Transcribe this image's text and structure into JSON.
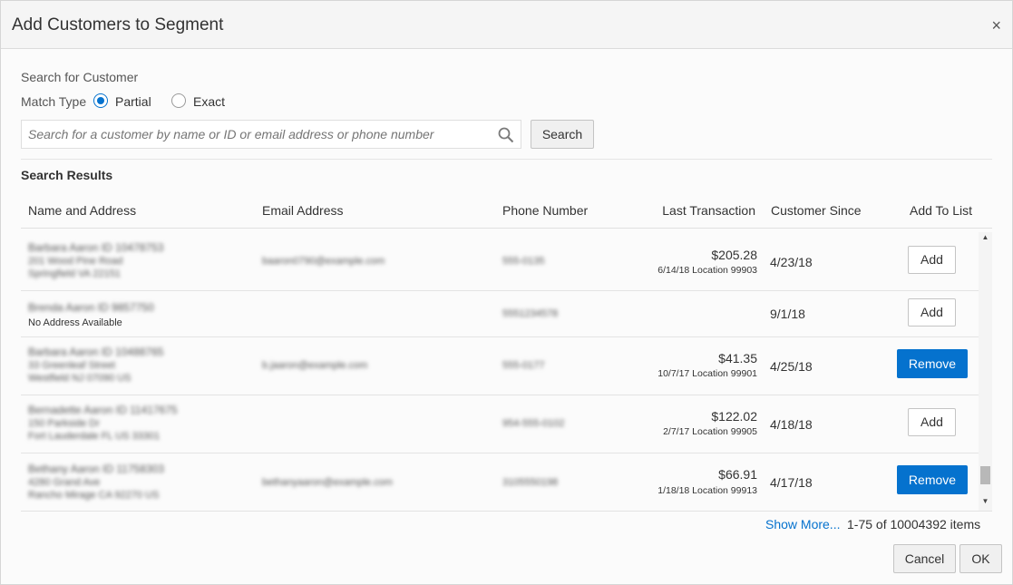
{
  "dialog": {
    "title": "Add Customers to Segment",
    "close_glyph": "×"
  },
  "search": {
    "section_label": "Search for Customer",
    "match_type_label": "Match Type",
    "options": [
      {
        "label": "Partial",
        "selected": true
      },
      {
        "label": "Exact",
        "selected": false
      }
    ],
    "placeholder": "Search for a customer by name or ID or email address or phone number",
    "value": "",
    "button_label": "Search"
  },
  "results": {
    "title": "Search Results",
    "columns": {
      "name": "Name and Address",
      "email": "Email Address",
      "phone": "Phone Number",
      "last_transaction": "Last Transaction",
      "since": "Customer Since",
      "add": "Add To List"
    },
    "rows": [
      {
        "name": "Barbara Aaron ID 10478753",
        "address1": "201 Wood Pine Road",
        "address2": "Springfield VA 22151",
        "email": "baaron0790@example.com",
        "phone": "555-0135",
        "amount": "$205.28",
        "txn_detail": "6/14/18 Location 99903",
        "since": "4/23/18",
        "action": "Add"
      },
      {
        "name": "Brenda Aaron ID 9857750",
        "address1": "No Address Available",
        "email": "",
        "phone": "5551234578",
        "amount": "",
        "txn_detail": "",
        "since": "9/1/18",
        "action": "Add"
      },
      {
        "name": "Barbara Aaron ID 10488765",
        "address1": "33 Greenleaf Street",
        "address2": "Westfield NJ 07090 US",
        "email": "b.jaaron@example.com",
        "phone": "555-0177",
        "amount": "$41.35",
        "txn_detail": "10/7/17 Location 99901",
        "since": "4/25/18",
        "action": "Remove"
      },
      {
        "name": "Bernadette Aaron ID 11417675",
        "address1": "150 Parkside Dr",
        "address2": "Fort Lauderdale FL US 33301",
        "email": "",
        "phone": "954-555-0102",
        "amount": "$122.02",
        "txn_detail": "2/7/17 Location 99905",
        "since": "4/18/18",
        "action": "Add"
      },
      {
        "name": "Bethany Aaron ID 11758303",
        "address1": "4280 Grand Ave",
        "address2": "Rancho Mirage CA 92270 US",
        "email": "bethanyaaron@example.com",
        "phone": "3105550198",
        "amount": "$66.91",
        "txn_detail": "1/18/18 Location 99913",
        "since": "4/17/18",
        "action": "Remove"
      }
    ],
    "show_more": "Show More...",
    "count_text": "1-75 of 10004392 items"
  },
  "footer": {
    "cancel_label": "Cancel",
    "ok_label": "OK"
  },
  "colors": {
    "accent": "#0572ce",
    "header_bg": "#f5f5f5",
    "body_bg": "#fbfbfb"
  },
  "icons": {
    "search": "search-icon",
    "close": "close-icon"
  }
}
